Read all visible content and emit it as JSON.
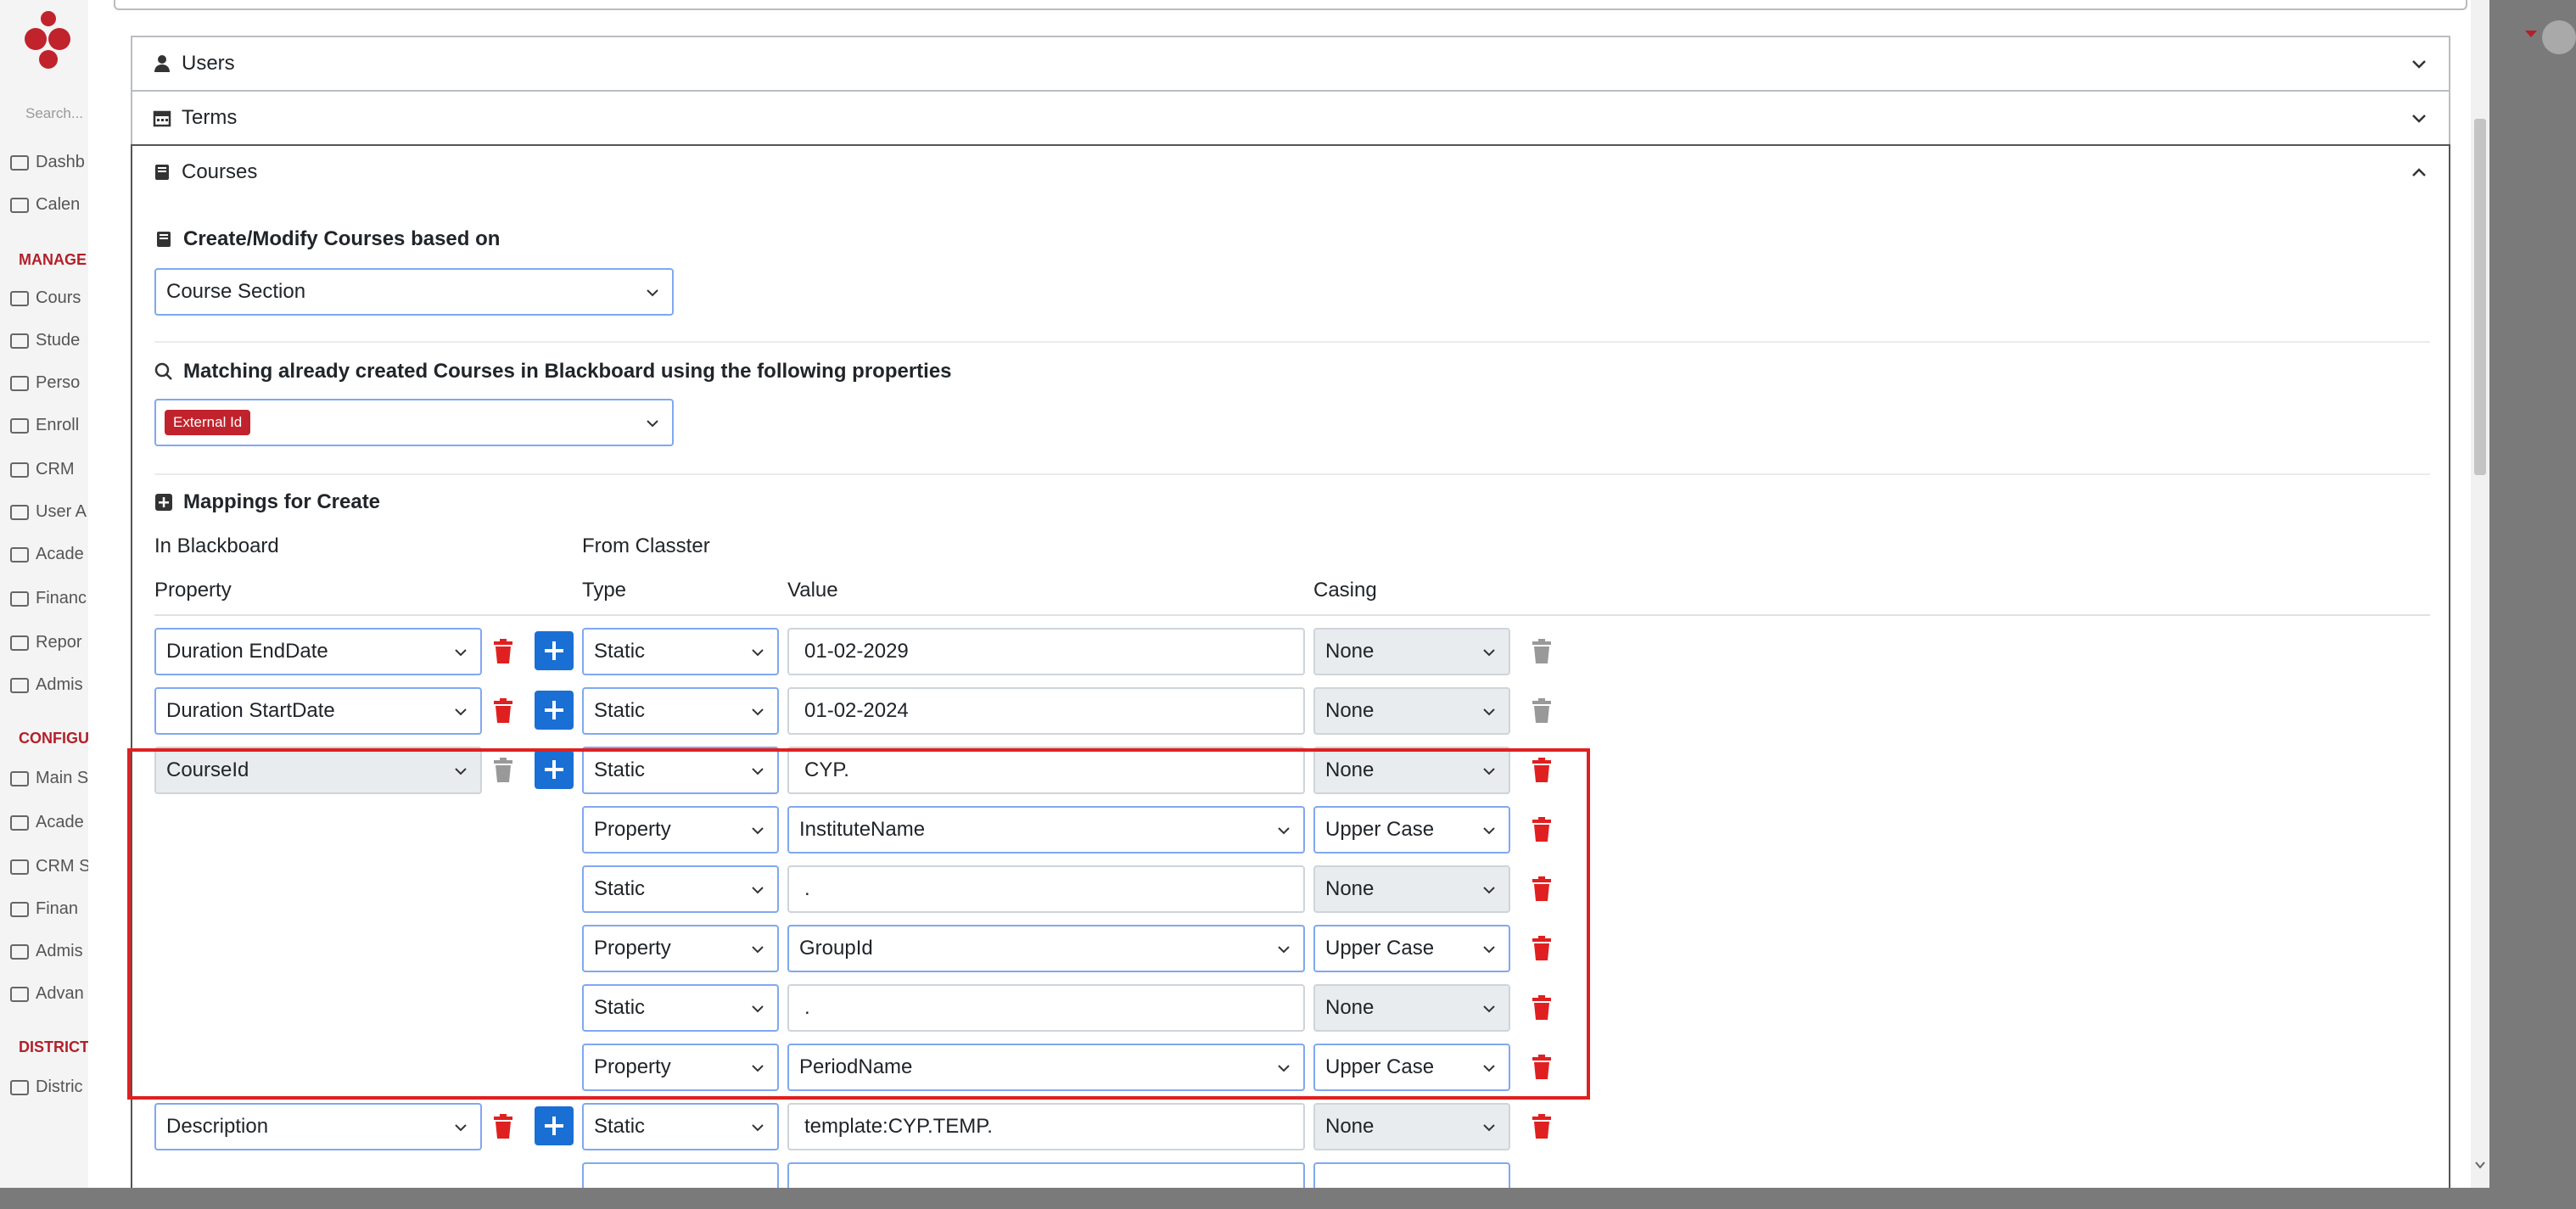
{
  "sidebar": {
    "search_placeholder": "Search...",
    "items_top": [
      {
        "label": "Dashb"
      },
      {
        "label": "Calen"
      }
    ],
    "heading_manage": "MANAGE",
    "items_manage": [
      {
        "label": "Cours"
      },
      {
        "label": "Stude"
      },
      {
        "label": "Perso"
      },
      {
        "label": "Enroll"
      },
      {
        "label": "CRM"
      },
      {
        "label": "User A"
      },
      {
        "label": "Acade"
      },
      {
        "label": "Financ"
      },
      {
        "label": "Repor"
      },
      {
        "label": "Admis"
      }
    ],
    "heading_config": "CONFIGU",
    "items_config": [
      {
        "label": "Main S"
      },
      {
        "label": "Acade"
      },
      {
        "label": "CRM S"
      },
      {
        "label": "Finan"
      },
      {
        "label": "Admis"
      },
      {
        "label": "Advan"
      }
    ],
    "heading_district": "DISTRICT",
    "items_district": [
      {
        "label": "Distric"
      }
    ]
  },
  "accordion": {
    "users_label": "Users",
    "terms_label": "Terms",
    "courses_label": "Courses"
  },
  "courses": {
    "create_modify_title": "Create/Modify Courses based on",
    "create_modify_value": "Course Section",
    "matching_title": "Matching already created Courses in Blackboard using the following properties",
    "matching_badge": "External Id",
    "mappings_title": "Mappings for Create",
    "col_in_blackboard": "In Blackboard",
    "col_from_classter": "From Classter",
    "col_property": "Property",
    "col_type": "Type",
    "col_value": "Value",
    "col_casing": "Casing",
    "rows": [
      {
        "property": "Duration EndDate",
        "type": "Static",
        "value": "01-02-2029",
        "casing": "None"
      },
      {
        "property": "Duration StartDate",
        "type": "Static",
        "value": "01-02-2024",
        "casing": "None"
      },
      {
        "property": "CourseId",
        "type": "Static",
        "value": "CYP.",
        "casing": "None"
      },
      {
        "property": "",
        "type": "Property",
        "value": "InstituteName",
        "casing": "Upper Case"
      },
      {
        "property": "",
        "type": "Static",
        "value": ".",
        "casing": "None"
      },
      {
        "property": "",
        "type": "Property",
        "value": "GroupId",
        "casing": "Upper Case"
      },
      {
        "property": "",
        "type": "Static",
        "value": ".",
        "casing": "None"
      },
      {
        "property": "",
        "type": "Property",
        "value": "PeriodName",
        "casing": "Upper Case"
      },
      {
        "property": "Description",
        "type": "Static",
        "value": "template:CYP.TEMP.",
        "casing": "None"
      }
    ]
  },
  "colors": {
    "accent_blue": "#1a6fd4",
    "danger_red": "#e02020",
    "badge_red": "#c0232c",
    "highlight_red": "#e02020"
  }
}
